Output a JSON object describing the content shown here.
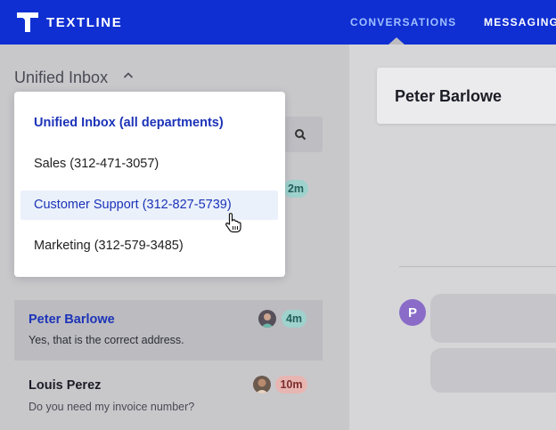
{
  "app": {
    "brand": "TEXTLINE",
    "nav": {
      "conversations": "CONVERSATIONS",
      "messaging": "MESSAGING"
    },
    "accent": "#0f2fd2"
  },
  "inbox": {
    "title": "Unified Inbox",
    "dropdown": {
      "items": [
        {
          "label": "Unified Inbox (all departments)",
          "state": "selected"
        },
        {
          "label": "Sales (312-471-3057)",
          "state": "normal"
        },
        {
          "label": "Customer Support (312-827-5739)",
          "state": "hover"
        },
        {
          "label": "Marketing (312-579-3485)",
          "state": "normal"
        }
      ]
    },
    "hidden_badge": "2m"
  },
  "conversations": [
    {
      "name": "Peter Barlowe",
      "message": "Yes, that is the correct address.",
      "time": "4m",
      "active": true,
      "time_color": "#9fd1cd"
    },
    {
      "name": "Louis Perez",
      "message": "Do you need my invoice number?",
      "time": "10m",
      "active": false,
      "time_color": "#e8b6b2"
    }
  ],
  "detail": {
    "contact_name": "Peter Barlowe",
    "avatar_initial": "P"
  }
}
